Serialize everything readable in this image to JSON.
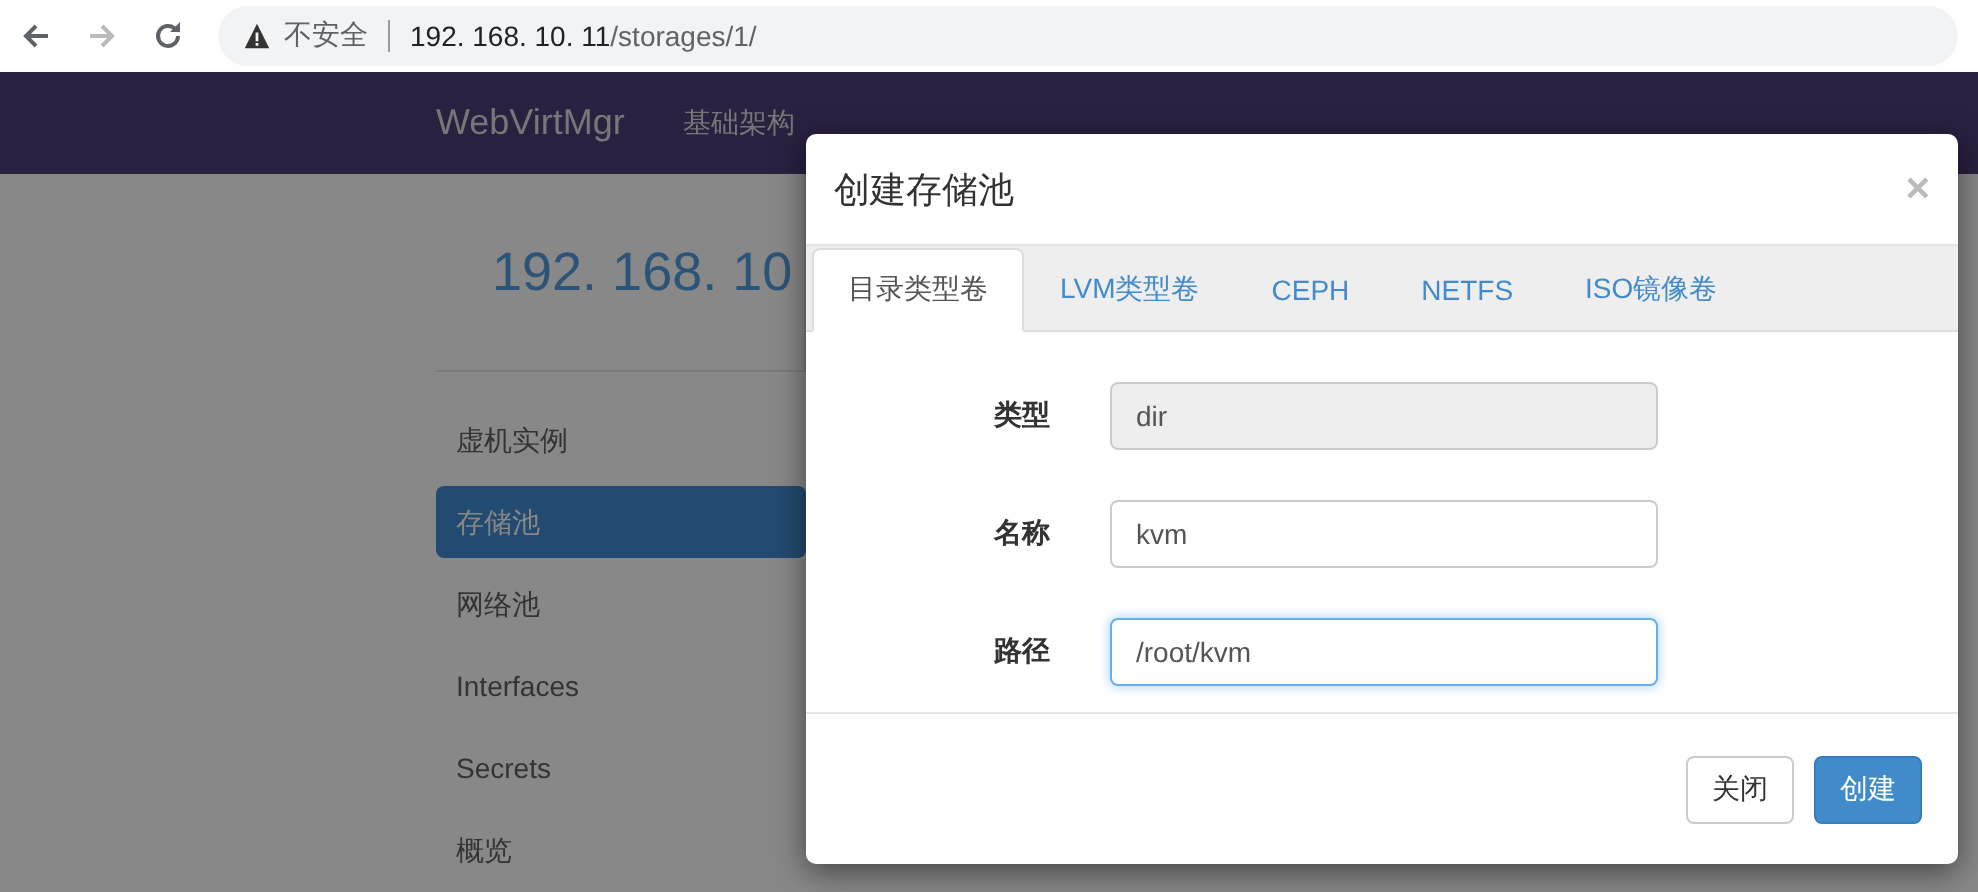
{
  "browser": {
    "insecure_label": "不安全",
    "url_host": "192. 168. 10. 11",
    "url_path": "/storages/1/"
  },
  "navbar": {
    "brand": "WebVirtMgr",
    "links": [
      "基础架构"
    ]
  },
  "page": {
    "heading": "192. 168. 10"
  },
  "sidebar": {
    "items": [
      {
        "label": "虚机实例",
        "selected": false
      },
      {
        "label": "存储池",
        "selected": true
      },
      {
        "label": "网络池",
        "selected": false
      },
      {
        "label": "Interfaces",
        "selected": false
      },
      {
        "label": "Secrets",
        "selected": false
      },
      {
        "label": "概览",
        "selected": false
      }
    ]
  },
  "modal": {
    "title": "创建存储池",
    "close": "×",
    "tabs": [
      {
        "label": "目录类型卷",
        "selected": true
      },
      {
        "label": "LVM类型卷",
        "selected": false
      },
      {
        "label": "CEPH",
        "selected": false
      },
      {
        "label": "NETFS",
        "selected": false
      },
      {
        "label": "ISO镜像卷",
        "selected": false
      }
    ],
    "fields": [
      {
        "label": "类型",
        "value": "dir",
        "disabled": true,
        "focused": false
      },
      {
        "label": "名称",
        "value": "kvm",
        "disabled": false,
        "focused": false
      },
      {
        "label": "路径",
        "value": "/root/kvm",
        "disabled": false,
        "focused": true
      }
    ],
    "buttons": [
      {
        "label": "关闭",
        "kind": "default"
      },
      {
        "label": "创建",
        "kind": "primary"
      }
    ]
  }
}
